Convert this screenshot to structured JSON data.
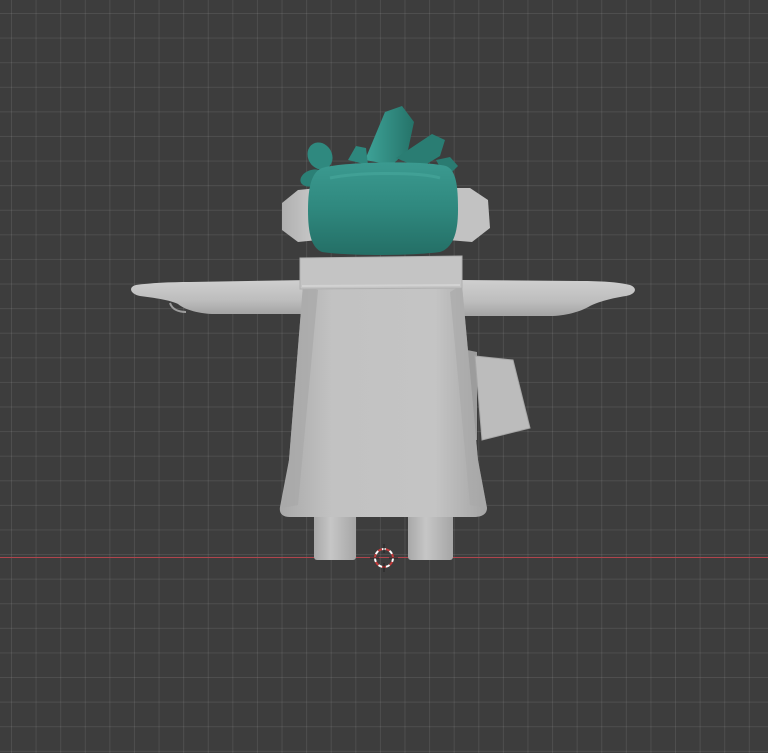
{
  "viewport": {
    "view": "back-orthographic",
    "colors": {
      "background": "#3d3d3d",
      "grid_line": "#474747",
      "x_axis": "#b0454d",
      "body_gray": "#c1c1c1",
      "hair_teal": "#2d857c",
      "cursor_red": "#c53b3b"
    },
    "model": {
      "name": "",
      "parts": [
        "hair-spikes",
        "head",
        "ears",
        "collar",
        "arms",
        "hands",
        "robe",
        "backpack-patch",
        "legs"
      ]
    },
    "cursor_icon": "3d-cursor-icon"
  }
}
